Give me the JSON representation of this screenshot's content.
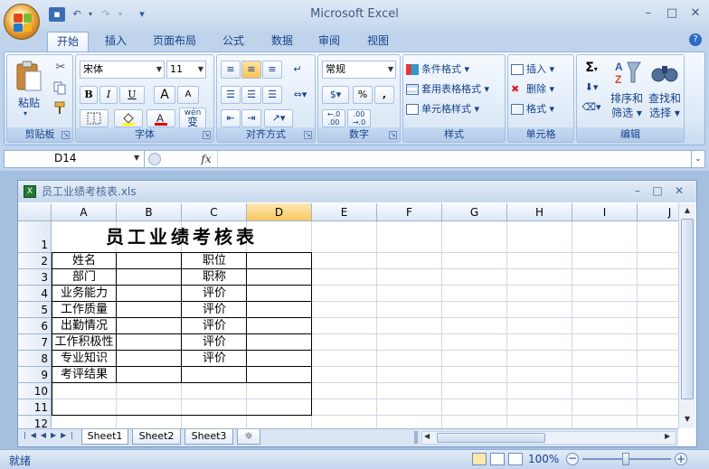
{
  "app": {
    "title": "Microsoft Excel"
  },
  "qat": {
    "save": "save-icon",
    "undo": "undo-icon",
    "redo": "redo-icon",
    "customize": "▾"
  },
  "window_controls": {
    "minimize": "–",
    "restore": "□",
    "close": "✕",
    "help": "?"
  },
  "ribbon_tabs": [
    "开始",
    "插入",
    "页面布局",
    "公式",
    "数据",
    "审阅",
    "视图"
  ],
  "ribbon": {
    "clipboard": {
      "label": "剪贴板",
      "paste": "粘贴"
    },
    "font": {
      "label": "字体",
      "name": "宋体",
      "size": "11",
      "bold": "B",
      "italic": "I",
      "underline": "U",
      "grow": "A",
      "shrink": "A",
      "wen": "wén",
      "bian": "变"
    },
    "alignment": {
      "label": "对齐方式"
    },
    "number": {
      "label": "数字",
      "format": "常规",
      "percent": "%",
      "comma": ",",
      "inc": ".0\n.00",
      "dec": ".00\n.0"
    },
    "styles": {
      "label": "样式",
      "conditional": "条件格式",
      "table": "套用表格格式",
      "cell": "单元格样式"
    },
    "cells": {
      "label": "单元格",
      "insert": "插入",
      "delete": "删除",
      "format": "格式"
    },
    "editing": {
      "label": "编辑",
      "sigma": "Σ",
      "sort1": "排序和",
      "sort2": "筛选",
      "find1": "查找和",
      "find2": "选择"
    }
  },
  "formula_bar": {
    "name_box": "D14",
    "fx": "fx",
    "value": ""
  },
  "document": {
    "title": "员工业绩考核表.xls"
  },
  "sheet": {
    "columns": [
      "A",
      "B",
      "C",
      "D",
      "E",
      "F",
      "G",
      "H",
      "I",
      "J"
    ],
    "selected_column": "D",
    "rows": [
      "1",
      "2",
      "3",
      "4",
      "5",
      "6",
      "7",
      "8",
      "9",
      "10",
      "11",
      "12"
    ],
    "title": "员工业绩考核表",
    "labels_a": [
      "姓名",
      "部门",
      "业务能力",
      "工作质量",
      "出勤情况",
      "工作积极性",
      "专业知识",
      "考评结果"
    ],
    "labels_c": [
      "职位",
      "职称",
      "评价",
      "评价",
      "评价",
      "评价",
      "评价"
    ]
  },
  "sheet_tabs": [
    "Sheet1",
    "Sheet2",
    "Sheet3"
  ],
  "status": {
    "mode": "就绪",
    "zoom": "100%"
  }
}
